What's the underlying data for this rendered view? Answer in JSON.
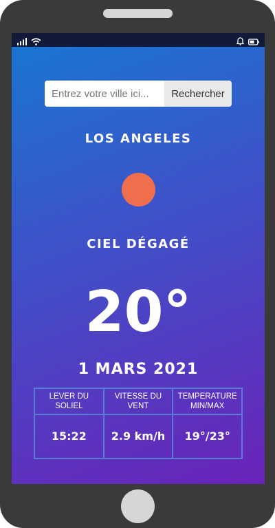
{
  "colors": {
    "accent_sun": "#ef6f4c",
    "gradient_start": "#1877d2",
    "gradient_end": "#6a23b8",
    "table_border": "#5a7cd8"
  },
  "statusbar": {
    "icons_left": [
      "signal-icon",
      "wifi-icon"
    ],
    "icons_right": [
      "bell-icon",
      "battery-icon"
    ]
  },
  "search": {
    "placeholder": "Entrez votre ville ici...",
    "value": "",
    "button_label": "Rechercher"
  },
  "weather": {
    "city": "LOS ANGELES",
    "icon": "sun-icon",
    "condition": "CIEL DÉGAGÉ",
    "temperature": "20°",
    "date": "1 MARS 2021"
  },
  "details": {
    "headers": [
      "LEVER DU SOLIEL",
      "VITESSE DU VENT",
      "TEMPERATURE MIN/MAX"
    ],
    "values": [
      "15:22",
      "2.9 km/h",
      "19°/23°"
    ]
  }
}
